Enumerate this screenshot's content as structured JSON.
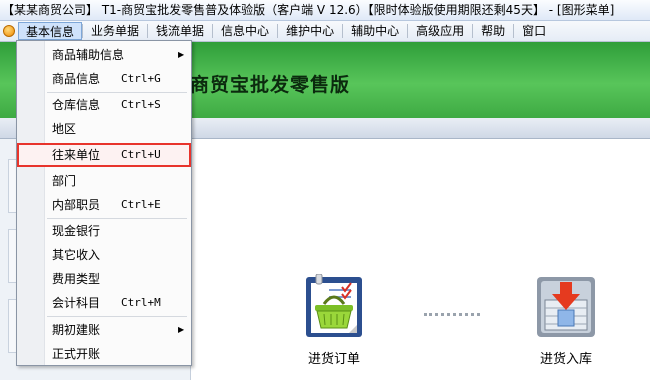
{
  "window": {
    "title": "【某某商贸公司】 T1-商贸宝批发零售普及体验版（客户端 V 12.6）【限时体验版使用期限还剩45天】 - [图形菜单]"
  },
  "menubar": {
    "items": [
      "基本信息",
      "业务单据",
      "钱流单据",
      "信息中心",
      "维护中心",
      "辅助中心",
      "高级应用",
      "帮助",
      "窗口"
    ]
  },
  "banner": {
    "title": "商贸宝批发零售版"
  },
  "dropdown": {
    "items": [
      {
        "label": "商品辅助信息",
        "shortcut": "",
        "submenu": true
      },
      {
        "label": "商品信息",
        "shortcut": "Ctrl+G",
        "submenu": false
      },
      {
        "label": "仓库信息",
        "shortcut": "Ctrl+S",
        "submenu": false
      },
      {
        "label": "地区",
        "shortcut": "",
        "submenu": false
      },
      {
        "label": "往来单位",
        "shortcut": "Ctrl+U",
        "submenu": false,
        "highlighted": true
      },
      {
        "label": "部门",
        "shortcut": "",
        "submenu": false
      },
      {
        "label": "内部职员",
        "shortcut": "Ctrl+E",
        "submenu": false
      },
      {
        "label": "现金银行",
        "shortcut": "",
        "submenu": false
      },
      {
        "label": "其它收入",
        "shortcut": "",
        "submenu": false
      },
      {
        "label": "费用类型",
        "shortcut": "",
        "submenu": false
      },
      {
        "label": "会计科目",
        "shortcut": "Ctrl+M",
        "submenu": false
      },
      {
        "label": "期初建账",
        "shortcut": "",
        "submenu": true
      },
      {
        "label": "正式开账",
        "shortcut": "",
        "submenu": false
      }
    ]
  },
  "shortcuts": {
    "purchase_order": "进货订单",
    "purchase_stock_in": "进货入库"
  },
  "icons": {
    "purchase_order": "shopping-basket-clipboard-icon",
    "purchase_stock_in": "stock-in-arrow-icon",
    "app": "app-logo-icon",
    "highlight_color": "#e8342c"
  }
}
